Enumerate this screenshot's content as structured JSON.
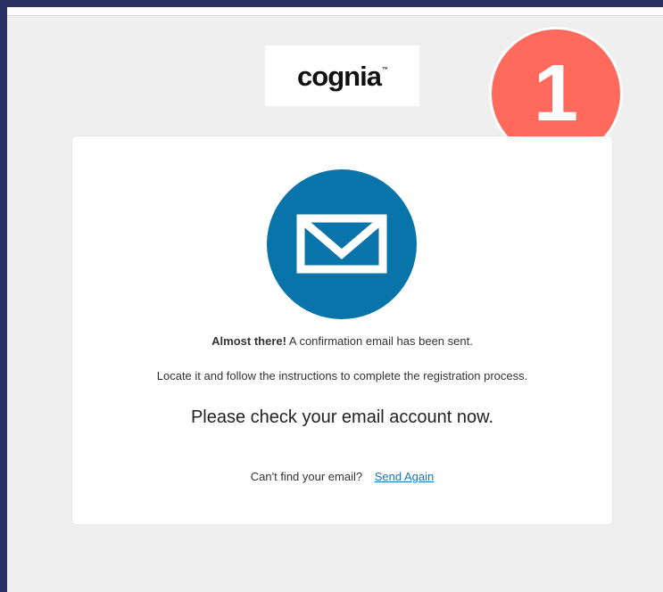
{
  "logo": {
    "text": "cognia",
    "trademark": "™"
  },
  "badge": {
    "number": "1"
  },
  "confirmation": {
    "lead": "Almost there!",
    "message": "A confirmation email has been sent.",
    "instructions": "Locate it and follow the instructions to complete the registration process.",
    "headline": "Please check your email account now.",
    "prompt": "Can't find your email?",
    "send_again": "Send Again"
  },
  "colors": {
    "accent_blue": "#0874aa",
    "link_blue": "#1c74b4",
    "badge_coral": "#ff6a5d"
  },
  "icons": {
    "mail": "envelope-icon"
  }
}
